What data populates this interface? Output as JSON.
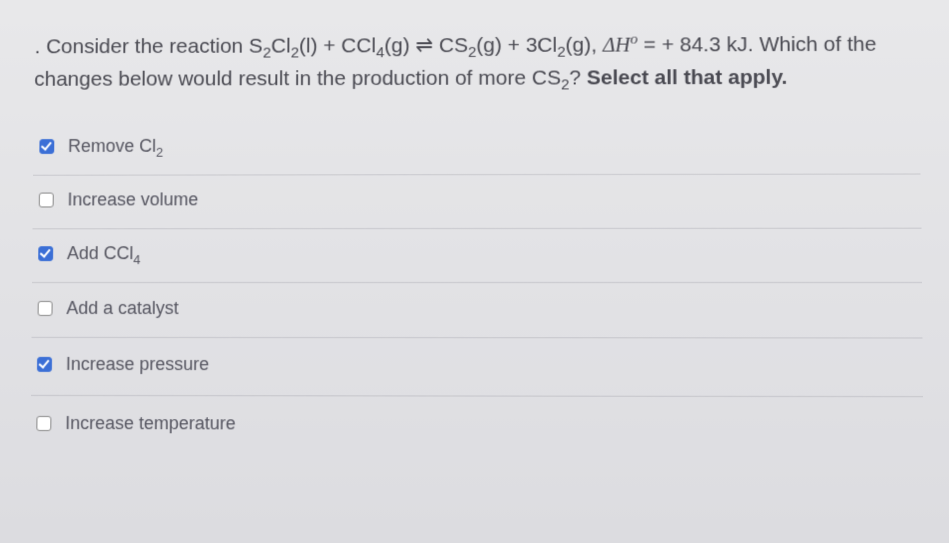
{
  "question": {
    "prefix": ". Consider the reaction S",
    "r1_sub": "2",
    "r1b": "Cl",
    "r1b_sub": "2",
    "r1_state": "(l) + CCl",
    "r2_sub": "4",
    "r2_state": "(g) ⇌ CS",
    "p1_sub": "2",
    "p1_state": "(g) + 3Cl",
    "p2_sub": "2",
    "p2_state": "(g), ",
    "deltaH": "ΔH",
    "degree": "o",
    "eq": " = + 84.3 kJ.  Which of the changes below would result in the production of more CS",
    "cs2_sub": "2",
    "tail": "?  ",
    "bold": "Select all that apply."
  },
  "options": [
    {
      "label_pre": "Remove Cl",
      "label_sub": "2",
      "label_post": "",
      "checked": true
    },
    {
      "label_pre": "Increase volume",
      "label_sub": "",
      "label_post": "",
      "checked": false
    },
    {
      "label_pre": "Add CCl",
      "label_sub": "4",
      "label_post": "",
      "checked": true
    },
    {
      "label_pre": "Add a catalyst",
      "label_sub": "",
      "label_post": "",
      "checked": false
    },
    {
      "label_pre": "Increase pressure",
      "label_sub": "",
      "label_post": "",
      "checked": true
    },
    {
      "label_pre": "Increase temperature",
      "label_sub": "",
      "label_post": "",
      "checked": false
    }
  ]
}
